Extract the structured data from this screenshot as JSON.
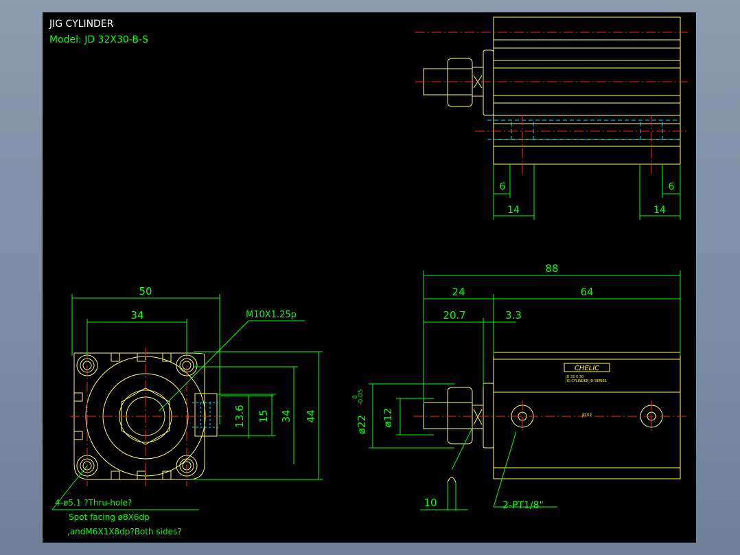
{
  "title": "JIG CYLINDER",
  "model": "Model: JD 32X30-B-S",
  "colors": {
    "outline": "#ffff66",
    "dim": "#00ff00",
    "center": "#ff2020",
    "hidden": "#00e0ff",
    "white": "#ffffff",
    "label_yellow": "#ffff00"
  },
  "dims": {
    "d50": "50",
    "d34": "34",
    "d13_6": "13.6",
    "d15": "15",
    "d34v": "34",
    "d44": "44",
    "d88": "88",
    "d24": "24",
    "d64": "64",
    "d20_7": "20.7",
    "d3_3": "3.3",
    "d6_left": "6",
    "d6_right": "6",
    "d14_left": "14",
    "d14_right": "14",
    "d10": "10",
    "d12": "ø12",
    "d22": "ø22",
    "d22_tol_upper": "0",
    "d22_tol_lower": "-0.05"
  },
  "notes": {
    "thread": "M10X1.25p",
    "holes_line1": "4-ø5.1 ?Thru-hole?",
    "holes_line2": "Spot facing ø8X6dp",
    "holes_line3": ",andM6X1X8dp?Both sides?",
    "port": "2-PT1/8\""
  },
  "label": {
    "brand": "CHELIC",
    "line1": "JD 32 X 30",
    "line2": "JIG CYLINDER  JD-SERIES"
  },
  "body_text": "JD32"
}
